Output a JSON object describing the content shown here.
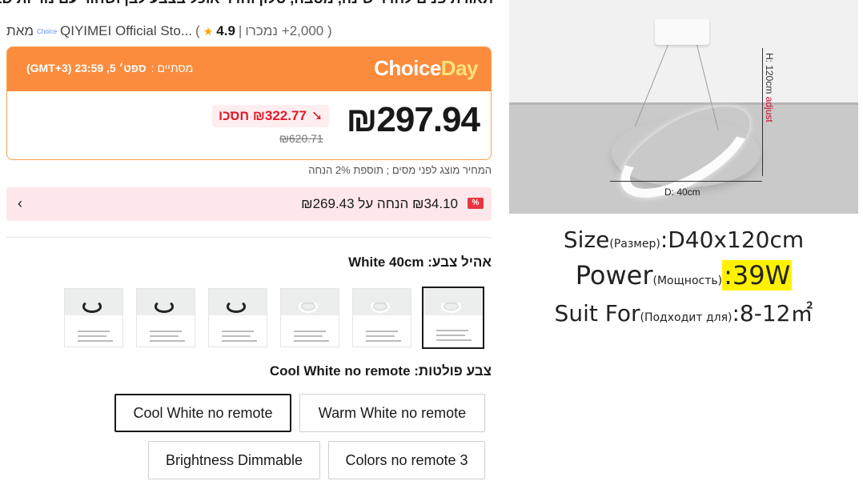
{
  "product": {
    "title": "תאורת פנים לחדר שינה, מטבח, סלון וחדר אוכל בצבע לבן ושחור עם נוריות LED",
    "store_prefix": "מאת",
    "store_name": "QIYIMEI Official Sto...",
    "rating": "4.9",
    "sold": "( 2,000+ נמכרו",
    "store_badge": "Choice"
  },
  "choice": {
    "logo_main": "Choice",
    "logo_day": "Day",
    "ends_label": "מסתיים :",
    "ends_value": "ספט׳ 5, 23:59 (GMT+3)",
    "price": "₪297.94",
    "save": "₪322.77 חסכו",
    "old_price": "₪620.71"
  },
  "tax_note": "המחיר מוצג לפני מסים ; תוספת 2% הנחה",
  "coupon": {
    "text": "₪34.10 הנחה על ₪269.43",
    "tag": "%"
  },
  "color": {
    "label": "אהיל צבע: White 40cm",
    "thumbs": [
      {
        "name": "black-60x120-78w",
        "dark": true
      },
      {
        "name": "black-60x120-52w",
        "dark": true
      },
      {
        "name": "black-40x120-39w",
        "dark": true
      },
      {
        "name": "white-60x120-78w",
        "dark": false
      },
      {
        "name": "white-60x120-52w",
        "dark": false
      },
      {
        "name": "white-40x120-39w",
        "dark": false
      }
    ]
  },
  "remote": {
    "label": "צבע פולטות: Cool White no remote",
    "options": [
      "Cool White no remote",
      "Warm White no remote",
      "Brightness Dimmable",
      "Colors no remote 3"
    ]
  },
  "image": {
    "height_label": "H: 120cm",
    "adjust": "adjust",
    "diameter_label": "D: 40cm",
    "size_main": "Size",
    "size_sub": "(Размер)",
    "size_val": ":D40x120cm",
    "power_main": "Power",
    "power_sub": "(Мощность)",
    "power_val": ":39W",
    "suit_main": "Suit For",
    "suit_sub": "(Подходит для)",
    "suit_val": ":8-12㎡"
  },
  "colors": {
    "choice_orange": "#fb8c3d",
    "sale_red": "#e01a2b",
    "highlight": "#fff200"
  }
}
